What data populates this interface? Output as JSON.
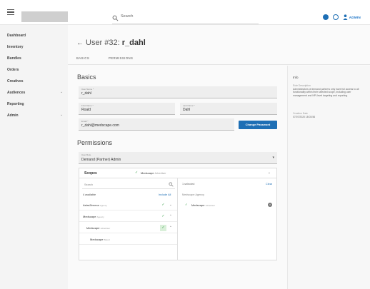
{
  "topbar": {
    "search_placeholder": "Search",
    "admin_label": "ADMIN"
  },
  "sidebar": {
    "items": [
      {
        "label": "Dashboard"
      },
      {
        "label": "Inventory"
      },
      {
        "label": "Bundles"
      },
      {
        "label": "Orders"
      },
      {
        "label": "Creatives"
      },
      {
        "label": "Audiences"
      },
      {
        "label": "Reporting"
      },
      {
        "label": "Admin"
      }
    ]
  },
  "header": {
    "title_prefix": "User #32: ",
    "title_user": "r_dahl"
  },
  "tabs": [
    {
      "label": "BASICS"
    },
    {
      "label": "PERMISSIONS"
    }
  ],
  "basics": {
    "section_title": "Basics",
    "user_name_label": "User Name *",
    "user_name_value": "r_dahl",
    "first_name_label": "First Name *",
    "first_name_value": "Roald",
    "last_name_label": "Last Name *",
    "last_name_value": "Dahl",
    "email_label": "Email *",
    "email_value": "r_dahl@medscape.com",
    "change_password_label": "Change Password"
  },
  "permissions": {
    "section_title": "Permissions",
    "role_label": "User Role",
    "role_value": "Demand (Partner) Admin"
  },
  "scopes": {
    "title": "Scopes",
    "selected_name": "Medscape",
    "selected_type": "Advertiser",
    "search_placeholder": "Search",
    "available_count": "4 available",
    "include_all": "Include All",
    "selected_count": "1 selected",
    "clear_label": "Clear",
    "right_group_label": "Medscape Agency",
    "right_item_name": "Medscape",
    "right_item_type": "Advertiser",
    "rows": [
      {
        "name": "AstraZeneca",
        "type": "Agency"
      },
      {
        "name": "Medscape",
        "type": "Agency"
      },
      {
        "name": "Medscape",
        "type": "Advertiser"
      },
      {
        "name": "Medscape",
        "type": "Brand"
      }
    ]
  },
  "info": {
    "title": "Info",
    "role_desc_label": "Role Description",
    "role_desc_text": "Administrators of demand partners only have full access to all functionality within their selected scope, including user management and NPI-level targeting and reporting.",
    "creation_label": "Creation Date",
    "creation_value": "07/07/2020 18:03:56"
  },
  "colors": {
    "accent": "#1e6fb5",
    "check": "#3aa14a"
  }
}
